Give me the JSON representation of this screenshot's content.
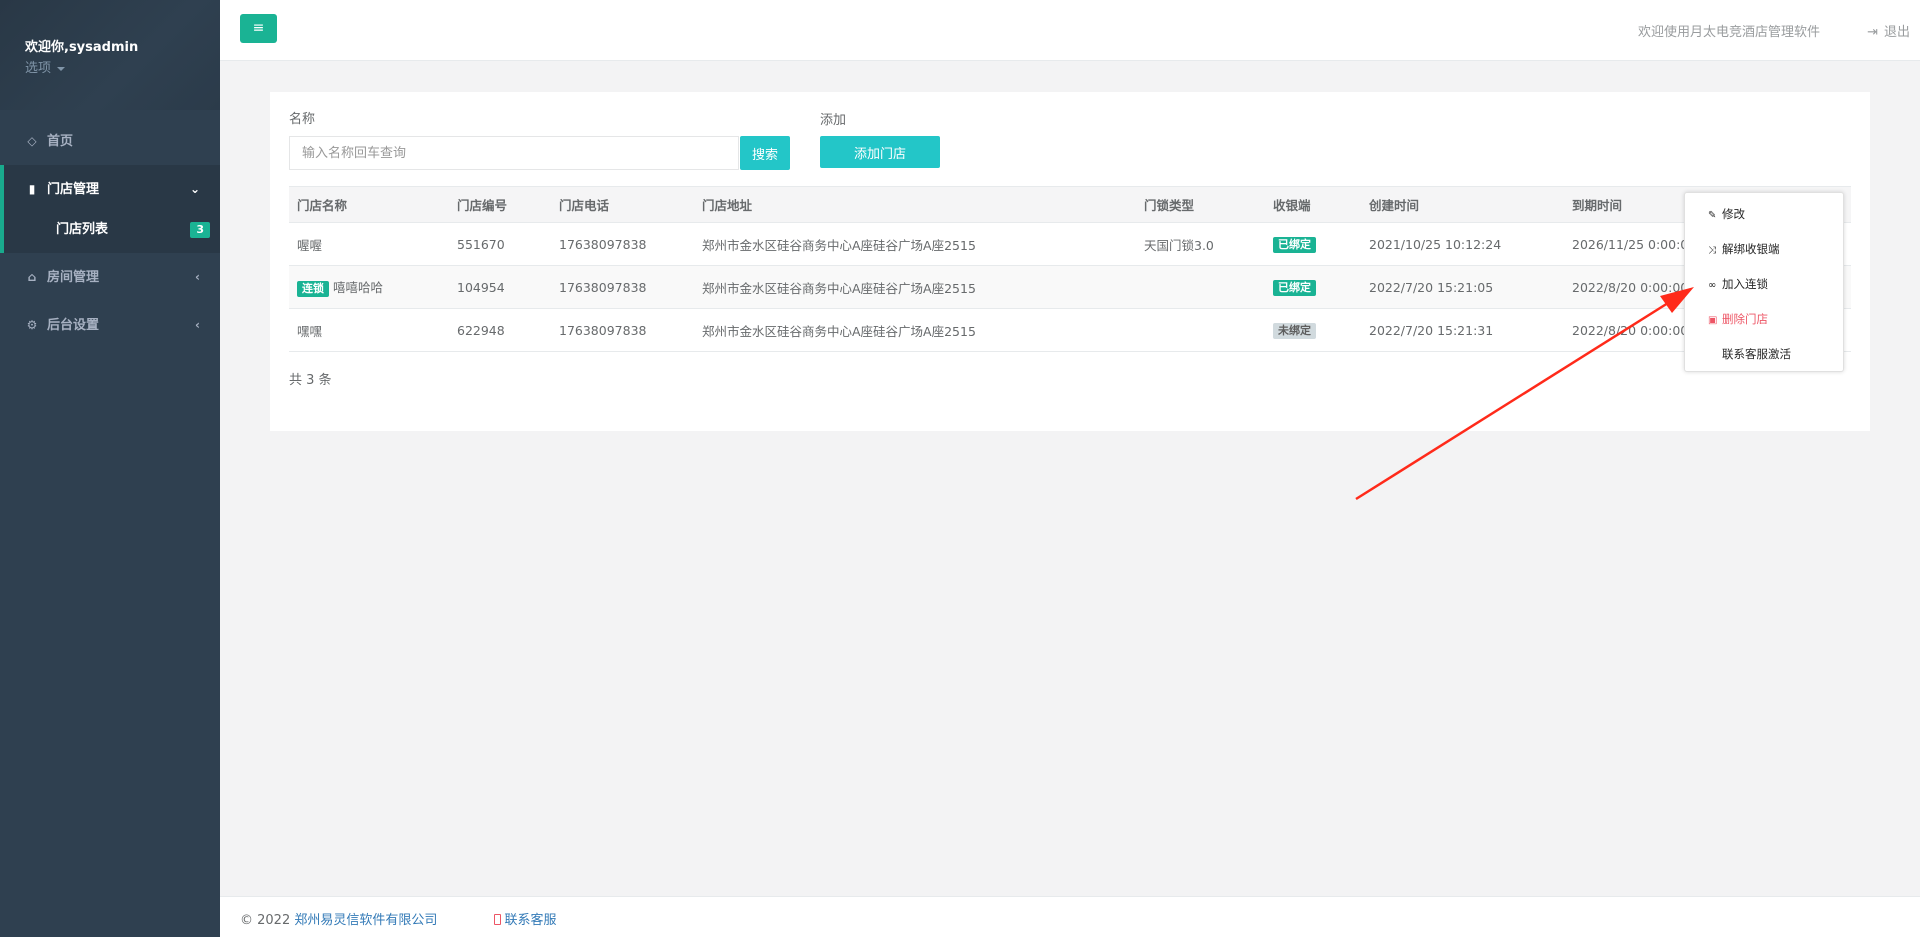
{
  "sidebar": {
    "user_welcome": "欢迎你,sysadmin",
    "options_label": "选项",
    "home": "首页",
    "store_group": "门店管理",
    "store_list": "门店列表",
    "store_list_badge": "3",
    "room_group": "房间管理",
    "settings_group": "后台设置"
  },
  "header": {
    "welcome": "欢迎使用月太电竞酒店管理软件",
    "logout": "退出"
  },
  "search": {
    "name_label": "名称",
    "placeholder": "输入名称回车查询",
    "search_button": "搜索",
    "add_label": "添加",
    "add_button": "添加门店"
  },
  "table": {
    "columns": [
      "门店名称",
      "门店编号",
      "门店电话",
      "门店地址",
      "门锁类型",
      "收银端",
      "创建时间",
      "到期时间"
    ],
    "rows": [
      {
        "tag": "",
        "name": "喔喔",
        "code": "551670",
        "phone": "17638097838",
        "address": "郑州市金水区硅谷商务中心A座硅谷广场A座2515",
        "lock": "天国门锁3.0",
        "cashier": "已绑定",
        "created": "2021/10/25 10:12:24",
        "expires": "2026/11/25 0:00:00"
      },
      {
        "tag": "连锁",
        "name": "嘻嘻哈哈",
        "code": "104954",
        "phone": "17638097838",
        "address": "郑州市金水区硅谷商务中心A座硅谷广场A座2515",
        "lock": "",
        "cashier": "已绑定",
        "created": "2022/7/20 15:21:05",
        "expires": "2022/8/20 0:00:00"
      },
      {
        "tag": "",
        "name": "嘿嘿",
        "code": "622948",
        "phone": "17638097838",
        "address": "郑州市金水区硅谷商务中心A座硅谷广场A座2515",
        "lock": "",
        "cashier": "未绑定",
        "created": "2022/7/20 15:21:31",
        "expires": "2022/8/20 0:00:00"
      }
    ],
    "total": "共 3 条"
  },
  "dropdown": {
    "edit": "修改",
    "unbind": "解绑收银端",
    "join_chain": "加入连锁",
    "delete": "删除门店",
    "contact_activate": "联系客服激活"
  },
  "footer": {
    "copyright": "© 2022 ",
    "company": "郑州易灵信软件有限公司",
    "contact": "联系客服"
  },
  "colors": {
    "sidebar_bg": "#2f4050",
    "accent_green": "#1ab394",
    "info_cyan": "#23c6c8",
    "danger_red": "#ed5565",
    "annotation_arrow": "#ff2a1a"
  }
}
